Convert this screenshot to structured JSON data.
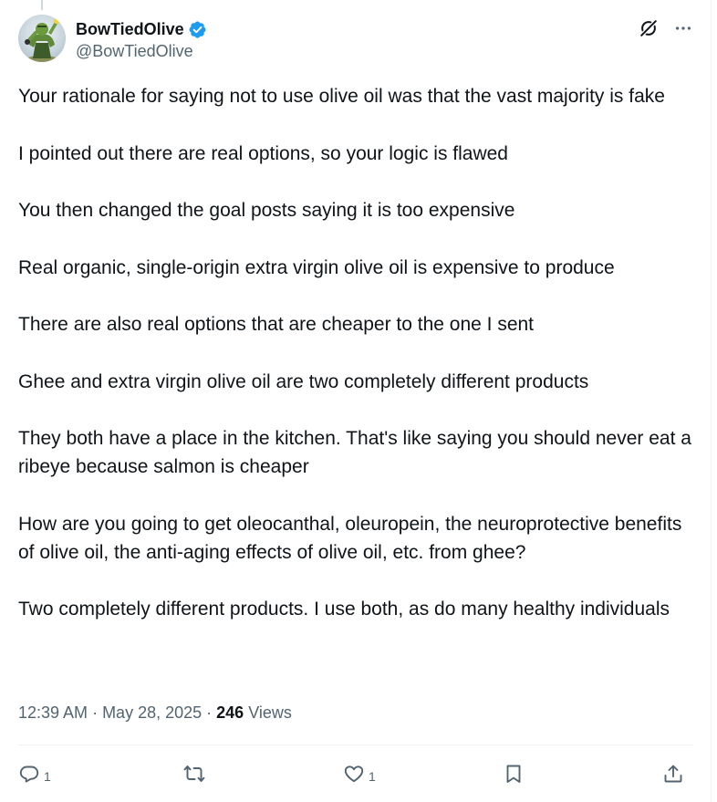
{
  "author": {
    "display_name": "BowTiedOlive",
    "handle": "@BowTiedOlive",
    "verified": true,
    "verified_color": "#1d9bf0"
  },
  "tweet": {
    "paragraphs": [
      "Your rationale for saying not to use olive oil was that the vast majority is fake",
      "I pointed out there are real options, so your logic is flawed",
      "You then changed the goal posts saying it is too expensive",
      "Real organic, single-origin extra virgin olive oil is expensive to produce",
      "There are also real options that are cheaper to the one I sent",
      "Ghee and extra virgin olive oil are two completely different products",
      "They both have a place in the kitchen. That's like saying you should never eat a ribeye because salmon is cheaper",
      "How are you going to get oleocanthal, oleuropein, the neuroprotective benefits of olive oil, the anti-aging effects of olive oil, etc. from ghee?",
      "Two completely different products. I use both, as do many healthy individuals"
    ]
  },
  "meta": {
    "time": "12:39 AM",
    "separator": "·",
    "date": "May 28, 2025",
    "views_count": "246",
    "views_label": "Views"
  },
  "actions": {
    "reply_count": "1",
    "retweet_count": "",
    "like_count": "1"
  },
  "icons": [
    "grok-icon",
    "more-icon",
    "reply-icon",
    "retweet-icon",
    "like-icon",
    "bookmark-icon",
    "share-icon",
    "verified-badge-icon"
  ],
  "colors": {
    "text_primary": "#0f1419",
    "text_secondary": "#536471",
    "accent": "#1d9bf0",
    "divider": "#eff3f4"
  }
}
